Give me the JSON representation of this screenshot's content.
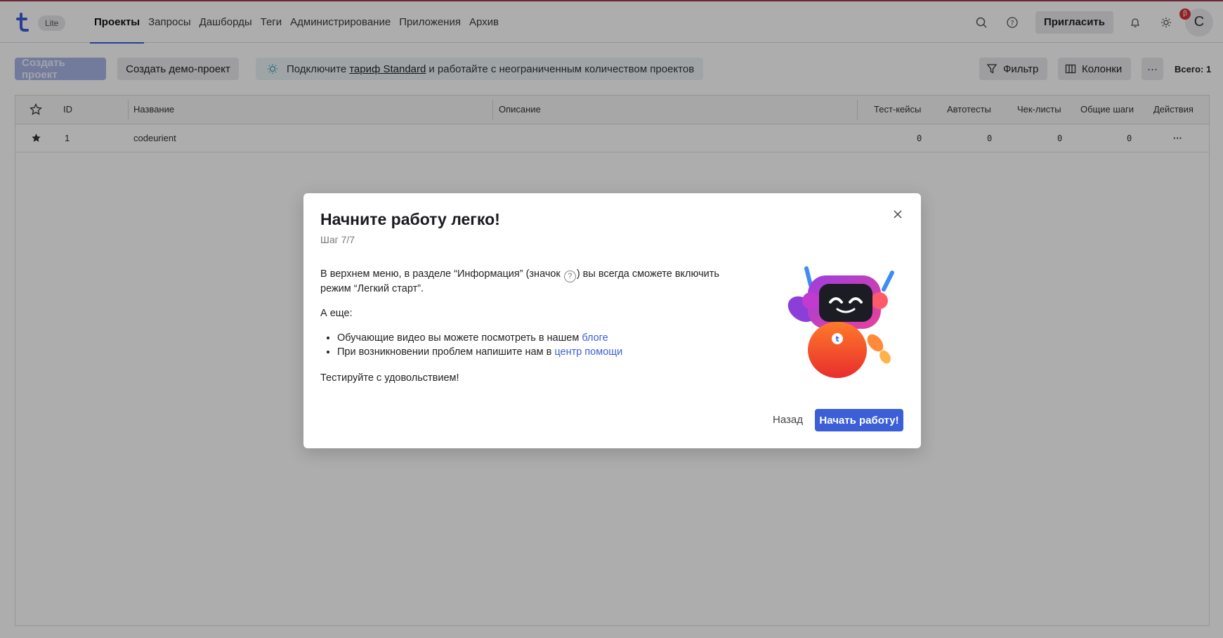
{
  "header": {
    "badge": "Lite",
    "nav": [
      "Проекты",
      "Запросы",
      "Дашборды",
      "Теги",
      "Администрирование",
      "Приложения",
      "Архив"
    ],
    "invite_label": "Пригласить",
    "beta_badge": "β",
    "avatar_letter": "C",
    "icons": [
      "search-icon",
      "help-icon",
      "bell-icon",
      "sun-icon"
    ]
  },
  "toolbar": {
    "create_label": "Создать проект",
    "demo_label": "Создать демо-проект",
    "promo_before": "Подключите",
    "promo_link": "тариф Standard",
    "promo_after": "и работайте с неограниченным количеством проектов",
    "filter_label": "Фильтр",
    "columns_label": "Колонки",
    "more_label": "···",
    "total_label": "Всего: 1"
  },
  "table": {
    "columns": [
      "ID",
      "Название",
      "Описание",
      "Тест-кейсы",
      "Автотесты",
      "Чек-листы",
      "Общие шаги",
      "Действия"
    ],
    "rows": [
      {
        "id": "1",
        "name": "codeurient",
        "description": "",
        "testcases": "0",
        "autotests": "0",
        "checklists": "0",
        "shared_steps": "0",
        "actions": "···"
      }
    ]
  },
  "modal": {
    "title": "Начните работу легко!",
    "step": "Шаг 7/7",
    "para1_before": "В верхнем меню, в разделе “Информация” (значок",
    "para1_icon": "?",
    "para1_after": ") вы всегда сможете включить режим “Легкий старт”.",
    "also": "А еще:",
    "bullet1_text": "Обучающие видео вы можете посмотреть в нашем",
    "bullet1_link": "блоге",
    "bullet2_text": "При возникновении проблем напишите нам в",
    "bullet2_link": "центр помощи",
    "closing": "Тестируйте с удовольствием!",
    "back_label": "Назад",
    "start_label": "Начать работу!"
  },
  "colors": {
    "accent": "#3c5fd8",
    "overlay": "rgba(0,0,0,0.32)",
    "beta": "#d8333a"
  }
}
